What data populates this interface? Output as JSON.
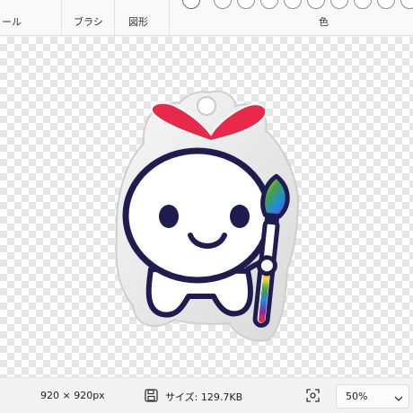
{
  "ribbon": {
    "tools_label": "ール",
    "brushes_label": "ブラシ",
    "shapes_label": "図形",
    "colors_label": "色"
  },
  "status": {
    "dimensions": "920 × 920px",
    "size": "サイズ: 129.7KB",
    "zoom": "50%"
  },
  "colors": {
    "heart": "#e8294a",
    "outline": "#1f1d4f",
    "body": "#ffffff",
    "checker": "#e6e6e6"
  }
}
